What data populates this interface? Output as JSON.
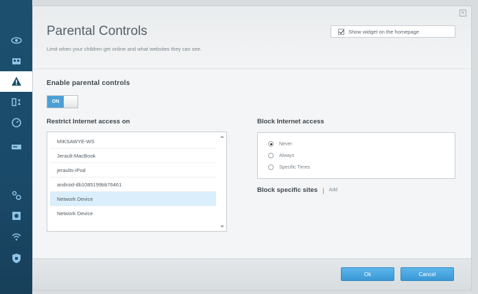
{
  "sidebar": {
    "items": [
      {
        "name": "nav-widgets",
        "icon": "eye-icon",
        "active": false
      },
      {
        "name": "nav-devices",
        "icon": "devices-icon",
        "active": false
      },
      {
        "name": "nav-parental",
        "icon": "warning-triangle-icon",
        "active": true
      },
      {
        "name": "nav-media",
        "icon": "media-prioritization-icon",
        "active": false
      },
      {
        "name": "nav-speed",
        "icon": "speedometer-icon",
        "active": false
      },
      {
        "name": "nav-external",
        "icon": "external-storage-icon",
        "active": false
      },
      {
        "name": "nav-connectivity",
        "icon": "gears-icon",
        "active": false
      },
      {
        "name": "nav-troubleshoot",
        "icon": "troubleshooting-icon",
        "active": false
      },
      {
        "name": "nav-wireless",
        "icon": "wifi-icon",
        "active": false
      },
      {
        "name": "nav-security",
        "icon": "shield-icon",
        "active": false
      }
    ]
  },
  "header": {
    "title": "Parental Controls",
    "subtitle": "Limit when your children get online and what websites they can see.",
    "show_widget_label": "Show widget on the homepage",
    "show_widget_checked": true
  },
  "enable": {
    "label": "Enable parental controls",
    "toggle_label": "ON"
  },
  "restrict": {
    "label": "Restrict Internet access on",
    "devices": [
      "MIKSAWYE-WS",
      "Jerault-MacBook",
      "jeraults-iPod",
      "android-db1085199bb76461",
      "Network Device",
      "Network Device"
    ],
    "selected_index": 4
  },
  "block": {
    "label": "Block Internet access",
    "options": [
      "Never",
      "Always",
      "Specific Times"
    ],
    "selected": "Never"
  },
  "sites": {
    "label": "Block specific sites",
    "separator": "|",
    "add_label": "Add"
  },
  "footer": {
    "ok_label": "Ok",
    "cancel_label": "Cancel"
  },
  "colors": {
    "sidebar": "#1c4f6e",
    "accent": "#4c9fd6",
    "selected_row": "#daeefb"
  }
}
